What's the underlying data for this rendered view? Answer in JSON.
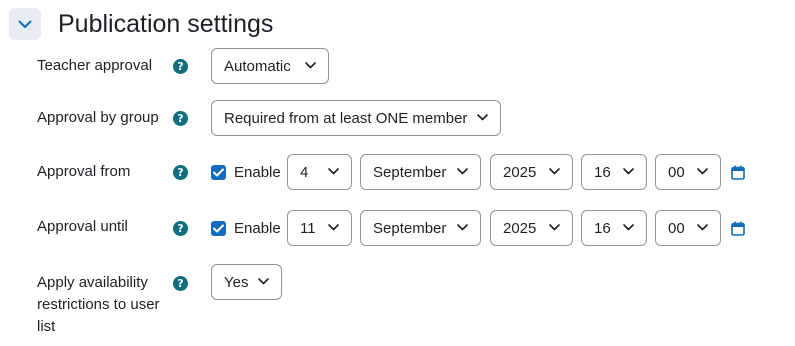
{
  "section": {
    "title": "Publication settings",
    "expanded": true
  },
  "fields": {
    "teacher_approval": {
      "label": "Teacher approval",
      "value": "Automatic"
    },
    "approval_by_group": {
      "label": "Approval by group",
      "value": "Required from at least ONE member"
    },
    "approval_from": {
      "label": "Approval from",
      "enable_label": "Enable",
      "enabled": true,
      "day": "4",
      "month": "September",
      "year": "2025",
      "hour": "16",
      "minute": "00"
    },
    "approval_until": {
      "label": "Approval until",
      "enable_label": "Enable",
      "enabled": true,
      "day": "11",
      "month": "September",
      "year": "2025",
      "hour": "16",
      "minute": "00"
    },
    "availability": {
      "label_lines": [
        "Apply availability",
        "restrictions to user",
        "list"
      ],
      "value": "Yes"
    }
  },
  "icons": {
    "help": "question-mark-circle-icon",
    "calendar": "calendar-icon",
    "chevron": "chevron-down-icon"
  },
  "colors": {
    "accent": "#0f6cbf",
    "help": "#0f6e7e",
    "border": "#8f959e",
    "collapse_bg": "#e7ecf3"
  }
}
